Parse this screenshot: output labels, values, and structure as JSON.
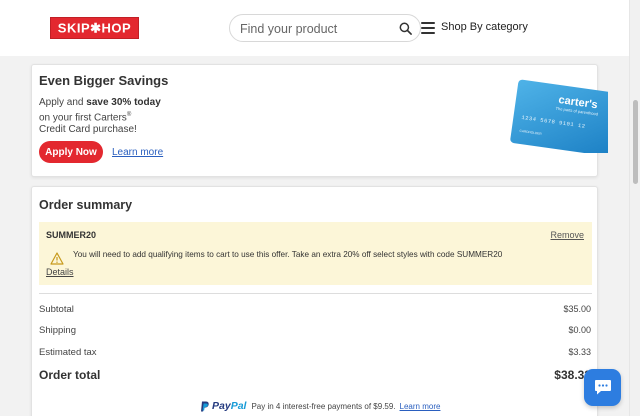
{
  "header": {
    "logo_text": "SKIP✱HOP",
    "search_placeholder": "Find your product",
    "category_label": "Shop By category"
  },
  "promo": {
    "title": "Even Bigger Savings",
    "text_prefix": "Apply and",
    "text_bold": "save 30% today",
    "text_line2_prefix": "on your first Carters",
    "text_line2_sup": "®",
    "text_line3": "Credit Card purchase!",
    "apply_label": "Apply Now",
    "learn_label": "Learn more",
    "card_brand": "carter's",
    "card_tagline": "The parts of parenthood",
    "card_number": "1234 5678 9101 12",
    "card_holder": "CARDHOLDER"
  },
  "summary": {
    "title": "Order summary",
    "coupon": {
      "code": "SUMMER20",
      "remove_label": "Remove",
      "message": "You will need to add qualifying items to cart to use this offer. Take an extra 20% off select styles with code SUMMER20",
      "details_label": "Details"
    },
    "rows": [
      {
        "label": "Subtotal",
        "value": "$35.00"
      },
      {
        "label": "Shipping",
        "value": "$0.00"
      },
      {
        "label": "Estimated tax",
        "value": "$3.33"
      }
    ],
    "total_label": "Order total",
    "total_value": "$38.33"
  },
  "paypal": {
    "brand_part1": "Pay",
    "brand_part2": "Pal",
    "message": "Pay in 4 interest-free payments of $9.59.",
    "learn_label": "Learn more"
  },
  "colors": {
    "brand_red": "#e3282f",
    "link_blue": "#2a5fbf",
    "coupon_bg": "#fcf6d8",
    "chat_blue": "#2d7de0"
  }
}
